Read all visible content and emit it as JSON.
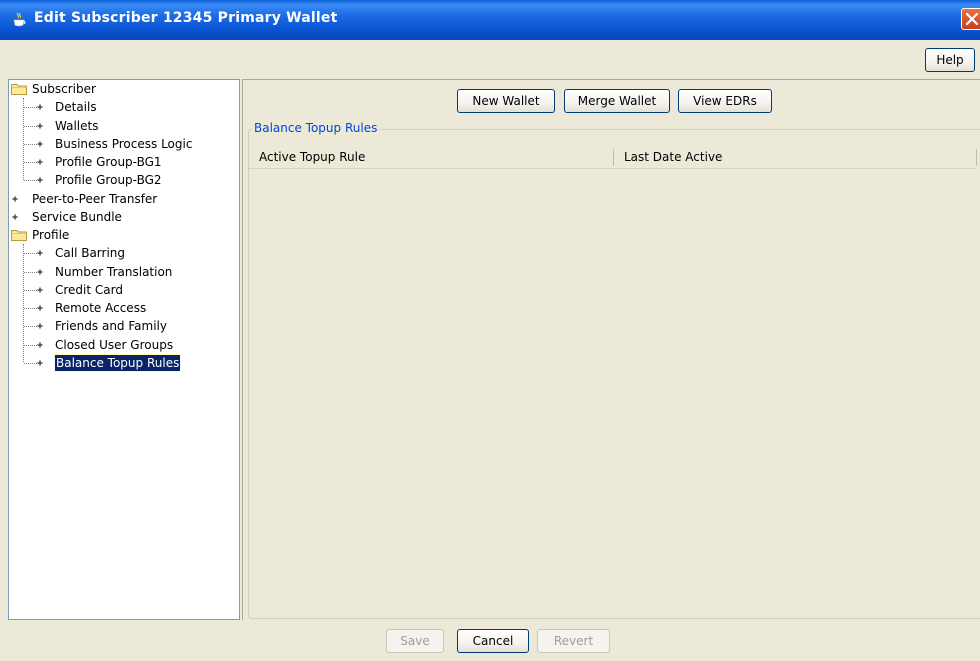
{
  "window": {
    "title": "Edit Subscriber 12345  Primary Wallet",
    "icon": "java-cup-icon",
    "close_icon": "close-icon",
    "accent": "#0b55d4"
  },
  "toolbar": {
    "help_label": "Help"
  },
  "tree": {
    "items": [
      {
        "label": "Subscriber",
        "type": "folder",
        "level": 0
      },
      {
        "label": "Details",
        "type": "leaf",
        "level": 1
      },
      {
        "label": "Wallets",
        "type": "leaf",
        "level": 1
      },
      {
        "label": "Business Process Logic",
        "type": "leaf",
        "level": 1
      },
      {
        "label": "Profile Group-BG1",
        "type": "leaf",
        "level": 1
      },
      {
        "label": "Profile Group-BG2",
        "type": "leaf",
        "level": 1
      },
      {
        "label": "Peer-to-Peer Transfer",
        "type": "leaf",
        "level": 0
      },
      {
        "label": "Service Bundle",
        "type": "leaf",
        "level": 0
      },
      {
        "label": "Profile",
        "type": "folder",
        "level": 0
      },
      {
        "label": "Call Barring",
        "type": "leaf",
        "level": 1
      },
      {
        "label": "Number Translation",
        "type": "leaf",
        "level": 1
      },
      {
        "label": "Credit Card",
        "type": "leaf",
        "level": 1
      },
      {
        "label": "Remote Access",
        "type": "leaf",
        "level": 1
      },
      {
        "label": "Friends and Family",
        "type": "leaf",
        "level": 1
      },
      {
        "label": "Closed User Groups",
        "type": "leaf",
        "level": 1
      },
      {
        "label": "Balance Topup Rules",
        "type": "leaf",
        "level": 1,
        "selected": true
      }
    ]
  },
  "main": {
    "buttons": {
      "new_wallet": "New Wallet",
      "merge_wallet": "Merge Wallet",
      "view_edrs": "View EDRs"
    },
    "group_title": "Balance Topup Rules",
    "table": {
      "columns": [
        "Active Topup Rule",
        "Last Date Active"
      ],
      "rows": []
    }
  },
  "footer": {
    "save_label": "Save",
    "cancel_label": "Cancel",
    "revert_label": "Revert",
    "save_enabled": false,
    "revert_enabled": false
  }
}
